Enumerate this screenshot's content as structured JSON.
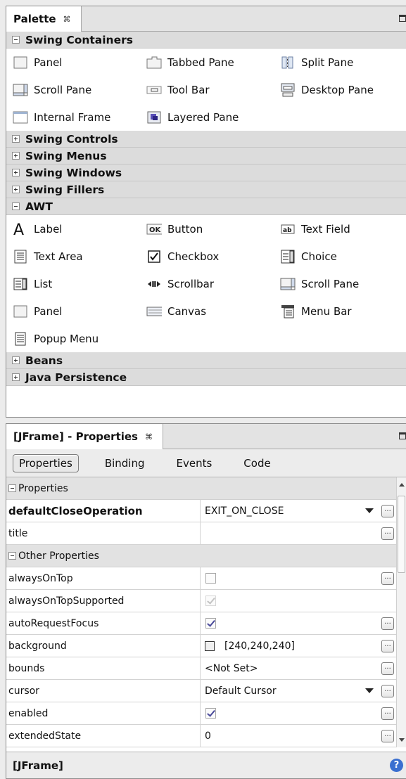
{
  "palette": {
    "title": "Palette",
    "categories": [
      {
        "label": "Swing Containers",
        "expanded": true,
        "items": [
          {
            "label": "Panel",
            "icon": "panel-icon"
          },
          {
            "label": "Tabbed Pane",
            "icon": "tabbed-pane-icon"
          },
          {
            "label": "Split Pane",
            "icon": "split-pane-icon"
          },
          {
            "label": "Scroll Pane",
            "icon": "scroll-pane-icon"
          },
          {
            "label": "Tool Bar",
            "icon": "tool-bar-icon"
          },
          {
            "label": "Desktop Pane",
            "icon": "desktop-pane-icon"
          },
          {
            "label": "Internal Frame",
            "icon": "internal-frame-icon"
          },
          {
            "label": "Layered Pane",
            "icon": "layered-pane-icon"
          }
        ]
      },
      {
        "label": "Swing Controls",
        "expanded": false
      },
      {
        "label": "Swing Menus",
        "expanded": false
      },
      {
        "label": "Swing Windows",
        "expanded": false
      },
      {
        "label": "Swing Fillers",
        "expanded": false
      },
      {
        "label": "AWT",
        "expanded": true,
        "items": [
          {
            "label": "Label",
            "icon": "label-icon"
          },
          {
            "label": "Button",
            "icon": "button-icon"
          },
          {
            "label": "Text Field",
            "icon": "text-field-icon"
          },
          {
            "label": "Text Area",
            "icon": "text-area-icon"
          },
          {
            "label": "Checkbox",
            "icon": "checkbox-icon"
          },
          {
            "label": "Choice",
            "icon": "choice-icon"
          },
          {
            "label": "List",
            "icon": "list-icon"
          },
          {
            "label": "Scrollbar",
            "icon": "scrollbar-icon"
          },
          {
            "label": "Scroll Pane",
            "icon": "scroll-pane-icon"
          },
          {
            "label": "Panel",
            "icon": "panel-icon"
          },
          {
            "label": "Canvas",
            "icon": "canvas-icon"
          },
          {
            "label": "Menu Bar",
            "icon": "menu-bar-icon"
          },
          {
            "label": "Popup Menu",
            "icon": "popup-menu-icon"
          }
        ]
      },
      {
        "label": "Beans",
        "expanded": false
      },
      {
        "label": "Java Persistence",
        "expanded": false
      }
    ]
  },
  "properties": {
    "title": "[JFrame] - Properties",
    "tabs": [
      "Properties",
      "Binding",
      "Events",
      "Code"
    ],
    "active_tab": "Properties",
    "rows": [
      {
        "kind": "section",
        "label": "Properties"
      },
      {
        "kind": "prop",
        "name": "defaultCloseOperation",
        "bold": true,
        "value": "EXIT_ON_CLOSE",
        "dropdown": true,
        "ellipsis": true
      },
      {
        "kind": "prop",
        "name": "title",
        "value": "",
        "ellipsis": true
      },
      {
        "kind": "section",
        "label": "Other Properties"
      },
      {
        "kind": "prop",
        "name": "alwaysOnTop",
        "checkbox": false,
        "ellipsis": true
      },
      {
        "kind": "prop",
        "name": "alwaysOnTopSupported",
        "checkbox": true,
        "dim": true
      },
      {
        "kind": "prop",
        "name": "autoRequestFocus",
        "checkbox": true,
        "ellipsis": true
      },
      {
        "kind": "prop",
        "name": "background",
        "value": "[240,240,240]",
        "swatch": "#f0f0f0",
        "ellipsis": true
      },
      {
        "kind": "prop",
        "name": "bounds",
        "value": "<Not Set>",
        "ellipsis": true
      },
      {
        "kind": "prop",
        "name": "cursor",
        "value": "Default Cursor",
        "dropdown": true,
        "ellipsis": true
      },
      {
        "kind": "prop",
        "name": "enabled",
        "checkbox": true,
        "ellipsis": true
      },
      {
        "kind": "prop",
        "name": "extendedState",
        "value": "0",
        "ellipsis": true
      }
    ],
    "footer": "[JFrame]",
    "help_glyph": "?"
  },
  "glyphs": {
    "close": "⌘",
    "ellipsis": "..."
  }
}
